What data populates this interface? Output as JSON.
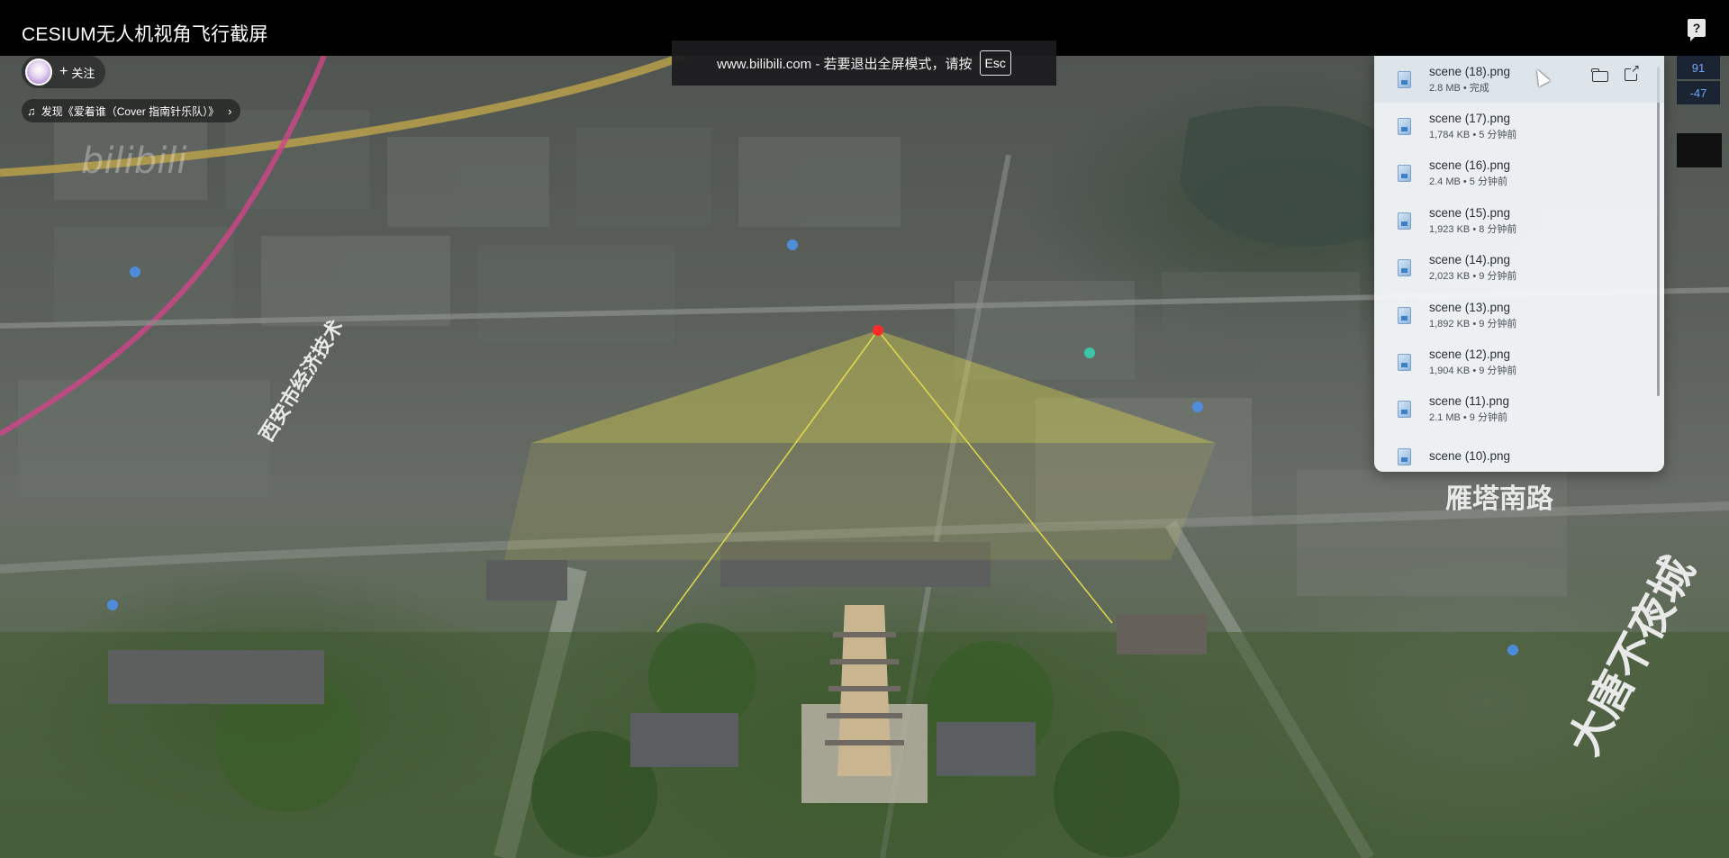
{
  "header": {
    "title": "CESIUM无人机视角飞行截屏",
    "help_glyph": "?"
  },
  "uploader": {
    "follow_label": "关注",
    "plus_glyph": "+"
  },
  "music": {
    "label": "发现《爱着谁（Cover 指南针乐队）》",
    "note_glyph": "♫",
    "chevron_glyph": "›"
  },
  "fullscreen_notice": {
    "text": "www.bilibili.com - 若要退出全屏模式，请按",
    "key": "Esc"
  },
  "side_readout": [
    "91",
    "-47"
  ],
  "downloads": {
    "items": [
      {
        "name": "scene (18).png",
        "meta": "2.8 MB • 完成"
      },
      {
        "name": "scene (17).png",
        "meta": "1,784 KB • 5 分钟前"
      },
      {
        "name": "scene (16).png",
        "meta": "2.4 MB • 5 分钟前"
      },
      {
        "name": "scene (15).png",
        "meta": "1,923 KB • 8 分钟前"
      },
      {
        "name": "scene (14).png",
        "meta": "2,023 KB • 9 分钟前"
      },
      {
        "name": "scene (13).png",
        "meta": "1,892 KB • 9 分钟前"
      },
      {
        "name": "scene (12).png",
        "meta": "1,904 KB • 9 分钟前"
      },
      {
        "name": "scene (11).png",
        "meta": "2.1 MB • 9 分钟前"
      },
      {
        "name": "scene (10).png",
        "meta": ""
      }
    ]
  },
  "map": {
    "road_labels": [
      "大唐不夜城",
      "雁塔南路",
      "西安市经济技术"
    ],
    "frustum_color": "#e6e04a",
    "drone_marker_color": "#ff2a2a"
  },
  "watermark": "bilibili"
}
